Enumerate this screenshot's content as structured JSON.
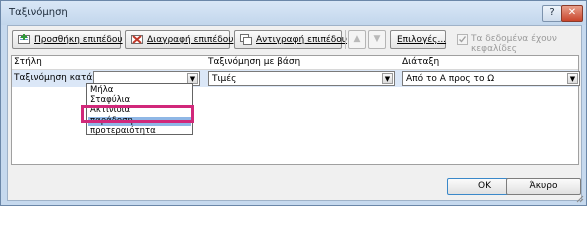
{
  "window": {
    "title": "Ταξινόμηση",
    "help_icon": "?",
    "close_icon": "✕"
  },
  "toolbar": {
    "add_level": "Προσθήκη επιπέδου",
    "delete_level": "Διαγραφή επιπέδου",
    "copy_level": "Αντιγραφή επιπέδου",
    "move_up_icon": "▲",
    "move_down_icon": "▼",
    "options": "Επιλογές...",
    "has_headers_label": "Τα δεδομένα έχουν κεφαλίδες",
    "has_headers_checked": true
  },
  "grid": {
    "headers": {
      "column": "Στήλη",
      "sort_on": "Ταξινόμηση με βάση",
      "order": "Διάταξη"
    },
    "row": {
      "label": "Ταξινόμηση κατά",
      "column_value": "",
      "sort_on_value": "Τιμές",
      "order_value": "Από το Α προς το Ω"
    }
  },
  "dropdown": {
    "options": [
      "Μήλα",
      "Σταφύλια",
      "Ακτινίδια",
      "παράδοση",
      "προτεραιότητα"
    ],
    "selected_index": 3
  },
  "footer": {
    "ok": "OK",
    "cancel": "Άκυρο"
  },
  "colors": {
    "highlight": "#d1287a",
    "selection": "#8fb7e6"
  }
}
